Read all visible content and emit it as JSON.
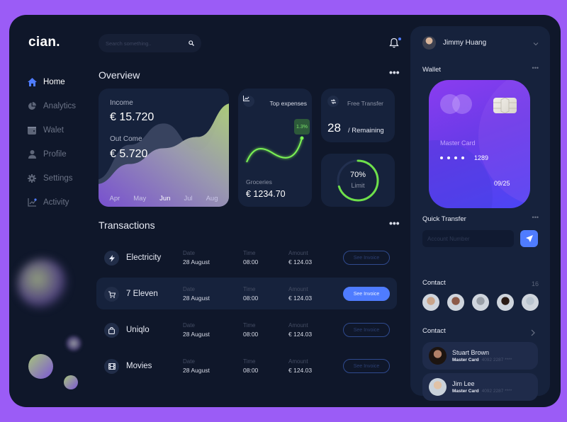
{
  "app": {
    "logo": "cian."
  },
  "sidebar": {
    "items": [
      {
        "label": "Home",
        "icon": "home-icon",
        "active": true
      },
      {
        "label": "Analytics",
        "icon": "pie-chart-icon"
      },
      {
        "label": "Walet",
        "icon": "wallet-icon"
      },
      {
        "label": "Profile",
        "icon": "user-icon"
      },
      {
        "label": "Settings",
        "icon": "gear-icon"
      },
      {
        "label": "Activity",
        "icon": "activity-chart-icon"
      }
    ]
  },
  "header": {
    "search_placeholder": "Search something..",
    "search_icon": "search-icon",
    "notification_icon": "bell-icon"
  },
  "overview": {
    "title": "Overview",
    "income": {
      "income_label": "Income",
      "income_value": "€ 15.720",
      "outcome_label": "Out Come",
      "outcome_value": "€ 5.720",
      "months": [
        "Apr",
        "May",
        "Jun",
        "Jul",
        "Aug"
      ],
      "active_month": "Jun"
    },
    "top_expenses": {
      "title": "Top expenses",
      "badge": "1.3%",
      "category": "Groceries",
      "amount": "€ 1234.70"
    },
    "free_transfer": {
      "title": "Free Transfer",
      "count": "28",
      "suffix": "/ Remaining"
    },
    "limit": {
      "percent_label": "70%",
      "percent": 70,
      "label": "Limit"
    }
  },
  "chart_data": {
    "type": "area",
    "title": "Income / Out Come",
    "categories": [
      "Apr",
      "May",
      "Jun",
      "Jul",
      "Aug"
    ],
    "series": [
      {
        "name": "Income",
        "values": [
          20,
          38,
          52,
          62,
          92
        ]
      },
      {
        "name": "Out Come",
        "values": [
          24,
          55,
          74,
          50,
          85
        ]
      }
    ],
    "xlabel": "",
    "ylabel": "",
    "grid": false,
    "legend": "none"
  },
  "transactions": {
    "title": "Transactions",
    "rows": [
      {
        "name": "Electricity",
        "icon": "lightning-icon",
        "date_label": "Date",
        "date": "28 August",
        "time_label": "Time",
        "time": "08:00",
        "amount_label": "Amount",
        "amount": "€ 124.03",
        "button": "See Invoice",
        "active": false
      },
      {
        "name": "7 Eleven",
        "icon": "cart-icon",
        "date_label": "Date",
        "date": "28 August",
        "time_label": "Time",
        "time": "08:00",
        "amount_label": "Amount",
        "amount": "€ 124.03",
        "button": "See Invoice",
        "active": true
      },
      {
        "name": "Uniqlo",
        "icon": "shopping-bag-icon",
        "date_label": "Date",
        "date": "28 August",
        "time_label": "Time",
        "time": "08:00",
        "amount_label": "Amount",
        "amount": "€ 124.03",
        "button": "See Invoice",
        "active": false
      },
      {
        "name": "Movies",
        "icon": "film-icon",
        "date_label": "Date",
        "date": "28 August",
        "time_label": "Time",
        "time": "08:00",
        "amount_label": "Amount",
        "amount": "€ 124.03",
        "button": "See Invoice",
        "active": false
      }
    ]
  },
  "right_panel": {
    "user_name": "Jimmy Huang",
    "wallet_title": "Wallet",
    "card": {
      "brand": "Master Card",
      "last_digits": "1289",
      "expiry": "09/25"
    },
    "quick_transfer": {
      "title": "Quick Transfer",
      "placeholder": "Account Number"
    },
    "contacts": {
      "title": "Contact",
      "count": "16",
      "avatar_colors": [
        "#c9a58b",
        "#8c5a48",
        "#9aa0a8",
        "#2a1a14",
        "#b9c4cf"
      ]
    },
    "contact_list": {
      "title": "Contact",
      "items": [
        {
          "name": "Stuart Brown",
          "card": "Master Card",
          "number": "4092 2287 ****"
        },
        {
          "name": "Jim Lee",
          "card": "Master Card",
          "number": "4092 2287 ****"
        }
      ]
    }
  },
  "colors": {
    "accent": "#4f7cff",
    "background": "#0f172a",
    "card": "#16223c",
    "frame": "#9b5cf6",
    "positive": "#6ee04a"
  }
}
